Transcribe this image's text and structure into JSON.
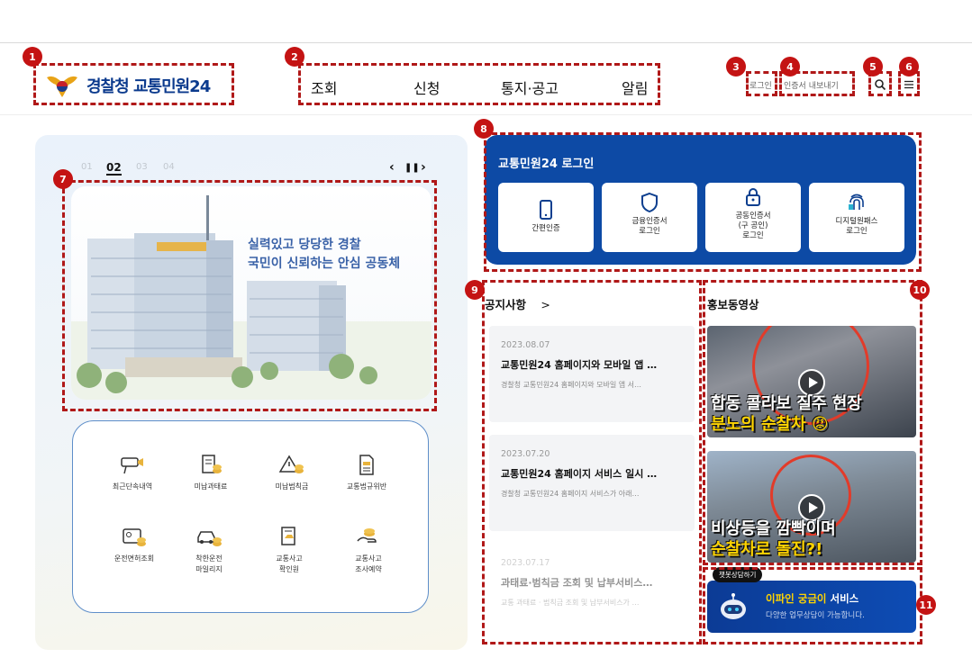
{
  "header": {
    "logo_text": "경찰청 교통민원24",
    "nav": [
      "조회",
      "신청",
      "통지·공고",
      "알림"
    ],
    "login_link": "로그인",
    "cert_export_link": "인증서 내보내기",
    "search_icon": "search-icon",
    "menu_icon": "hamburger-menu-icon"
  },
  "annotations": [
    "1",
    "2",
    "3",
    "4",
    "5",
    "6",
    "7",
    "8",
    "9",
    "10",
    "11"
  ],
  "carousel": {
    "pages": [
      "01",
      "02",
      "03",
      "04"
    ],
    "active_page": "02",
    "prev": "‹",
    "pause": "❚❚",
    "next": "›",
    "banner_line1": "실력있고 당당한 경찰",
    "banner_line2": "국민이 신뢰하는 안심 공동체"
  },
  "quick_menu": [
    {
      "label": "최근단속내역",
      "icon": "camera-icon"
    },
    {
      "label": "미납과태료",
      "icon": "receipt-coins-icon"
    },
    {
      "label": "미납범칙금",
      "icon": "warning-coins-icon"
    },
    {
      "label": "교통법규위반",
      "icon": "document-icon"
    },
    {
      "label": "운전면허조회",
      "icon": "license-card-icon"
    },
    {
      "label": "착한운전",
      "label2": "마일리지",
      "icon": "car-coins-icon"
    },
    {
      "label": "교통사고",
      "label2": "확인원",
      "icon": "accident-report-icon"
    },
    {
      "label": "교통사고",
      "label2": "조사예약",
      "icon": "hand-coins-icon"
    }
  ],
  "login": {
    "title": "교통민원24 로그인",
    "options": [
      {
        "line1": "간편인증",
        "icon": "smartphone-icon"
      },
      {
        "line1": "금융인증서",
        "line2": "로그인",
        "icon": "shield-icon"
      },
      {
        "line1": "공동인증서",
        "line2": "(구 공인)",
        "line3": "로그인",
        "icon": "lock-icon"
      },
      {
        "line1": "디지털원패스",
        "line2": "로그인",
        "icon": "fingerprint-icon"
      }
    ]
  },
  "notices": {
    "title": "공지사항",
    "more": ">",
    "items": [
      {
        "date": "2023.08.07",
        "title": "교통민원24 홈페이지와 모바일 앱 …",
        "summary": "경찰청 교통민원24 홈페이지와 모바일 앱 서…"
      },
      {
        "date": "2023.07.20",
        "title": "교통민원24 홈페이지 서비스 일시 …",
        "summary": "경찰청 교통민원24 홈페이지 서비스가 아래…"
      },
      {
        "date": "2023.07.17",
        "title": "과태료·범칙금 조회 및 납부서비스…",
        "summary": "교통 과태료 · 범칙금 조회 및 납부서비스가 …"
      }
    ]
  },
  "videos": {
    "title": "홍보동영상",
    "items": [
      {
        "caption1": "합동 콜라보 질주 현장",
        "caption2": "분노의 순찰차 😡"
      },
      {
        "caption1": "비상등을 깜빡이며",
        "caption2": "순찰차로 돌진?!"
      }
    ]
  },
  "chatbot": {
    "bubble": "챗봇상담하기",
    "title_highlight": "이파인 궁금이",
    "title_rest": " 서비스",
    "subtitle": "다양한 업무상담이 가능합니다."
  }
}
